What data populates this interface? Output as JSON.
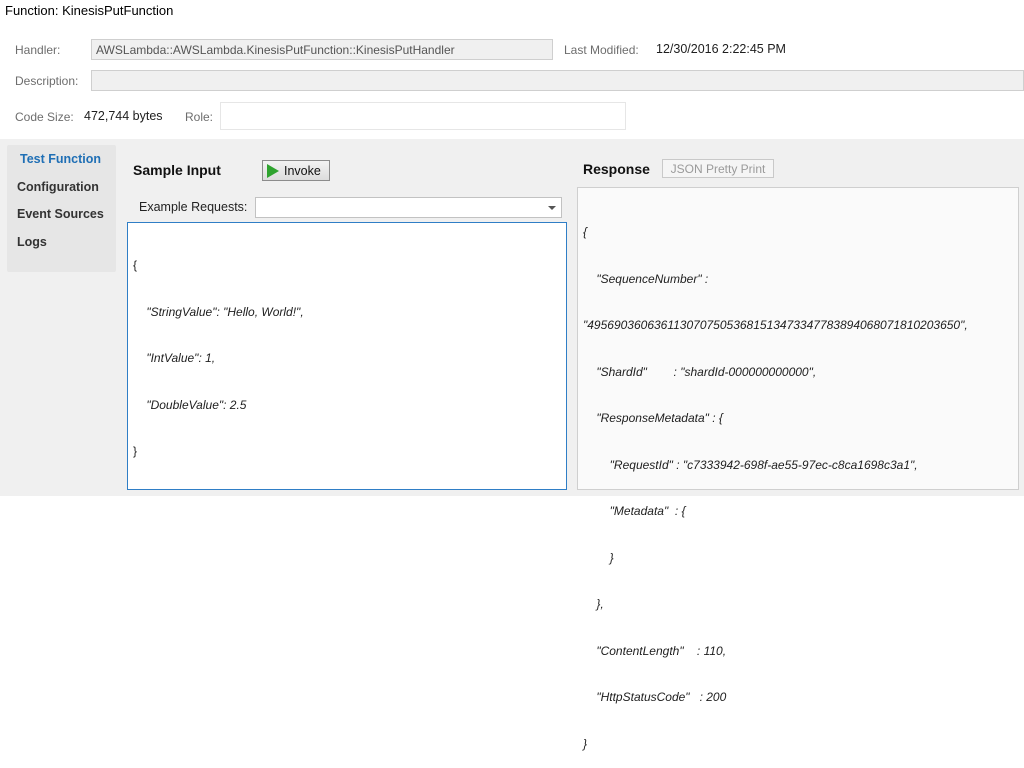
{
  "header": {
    "title": "Function: KinesisPutFunction",
    "handler_label": "Handler:",
    "handler_value": "AWSLambda::AWSLambda.KinesisPutFunction::KinesisPutHandler",
    "last_modified_label": "Last Modified:",
    "last_modified_value": "12/30/2016 2:22:45 PM",
    "description_label": "Description:",
    "description_value": "",
    "code_size_label": "Code Size:",
    "code_size_value": "472,744 bytes",
    "role_label": "Role:",
    "role_value": ""
  },
  "sidebar": {
    "items": [
      {
        "label": "Test Function",
        "active": true
      },
      {
        "label": "Configuration",
        "active": false
      },
      {
        "label": "Event Sources",
        "active": false
      },
      {
        "label": "Logs",
        "active": false
      }
    ]
  },
  "sample_input": {
    "title": "Sample Input",
    "invoke_label": "Invoke",
    "example_requests_label": "Example Requests:",
    "example_requests_value": "",
    "lines": [
      "{",
      "    \"StringValue\": \"Hello, World!\",",
      "    \"IntValue\": 1,",
      "    \"DoubleValue\": 2.5",
      "}"
    ]
  },
  "response": {
    "title": "Response",
    "pretty_print_label": "JSON Pretty Print",
    "lines": [
      "{",
      "    \"SequenceNumber\" :",
      "\"49569036063611307075053681513473347783894068071810203650\",",
      "    \"ShardId\"        : \"shardId-000000000000\",",
      "    \"ResponseMetadata\" : {",
      "        \"RequestId\" : \"c7333942-698f-ae55-97ec-c8ca1698c3a1\",",
      "        \"Metadata\"  : {",
      "        }",
      "    },",
      "    \"ContentLength\"    : 110,",
      "    \"HttpStatusCode\"   : 200",
      "}"
    ]
  },
  "colors": {
    "accent": "#1f6fb5",
    "invoke_icon": "#2ea32e",
    "panel_bg": "#f0f0f0",
    "editor_border": "#2f7ec6"
  },
  "icons": {
    "invoke": "play-icon",
    "combo": "chevron-down-icon"
  }
}
